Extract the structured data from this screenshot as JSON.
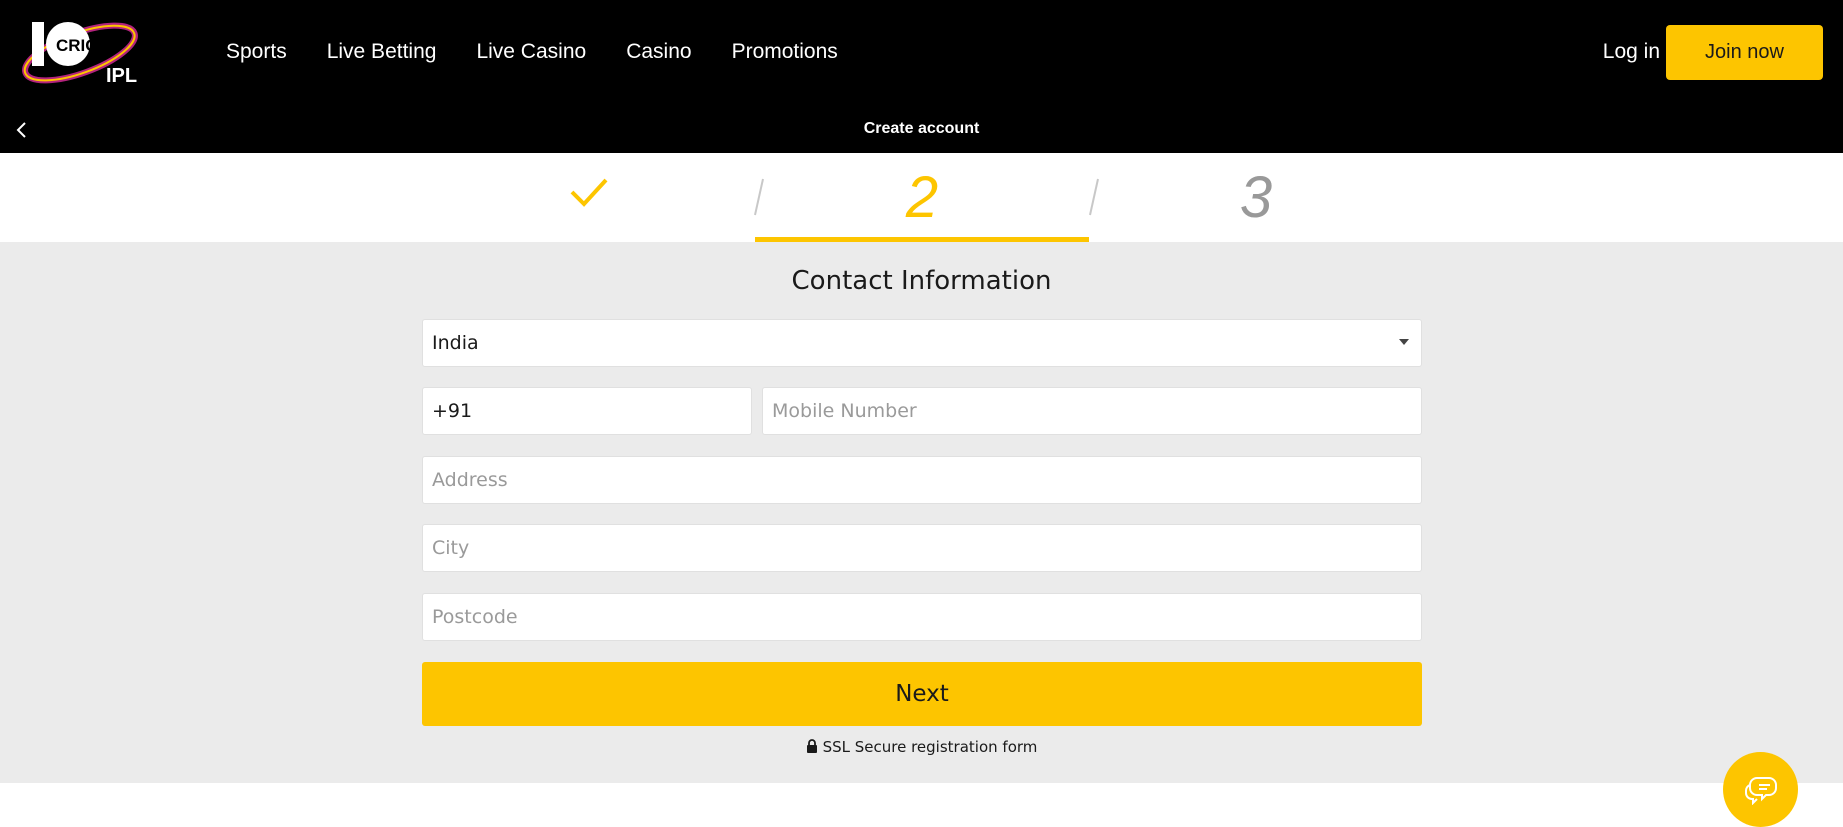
{
  "header": {
    "logo_text_top": "10CRIC",
    "logo_text_bottom": "IPL",
    "nav": [
      "Sports",
      "Live Betting",
      "Live Casino",
      "Casino",
      "Promotions"
    ],
    "login_label": "Log in",
    "join_label": "Join now",
    "page_title": "Create account"
  },
  "steps": {
    "step1_icon": "check-icon",
    "step2_label": "2",
    "step3_label": "3",
    "current_step": 2
  },
  "form": {
    "title": "Contact Information",
    "country_value": "India",
    "phone_prefix_value": "+91",
    "mobile_placeholder": "Mobile Number",
    "address_placeholder": "Address",
    "city_placeholder": "City",
    "postcode_placeholder": "Postcode",
    "next_label": "Next",
    "ssl_text": "SSL Secure registration form"
  },
  "colors": {
    "accent": "#fdc500",
    "header_bg": "#000000",
    "form_bg": "#ebebeb",
    "muted_step": "#999999"
  },
  "chat": {
    "icon": "chat-bubbles-icon"
  }
}
